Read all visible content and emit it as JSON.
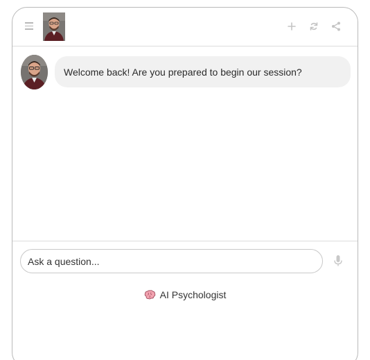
{
  "header": {
    "menu_icon": "hamburger-menu-icon",
    "avatar_alt": "psychologist-portrait",
    "actions": [
      {
        "icon": "plus-icon"
      },
      {
        "icon": "refresh-icon"
      },
      {
        "icon": "share-icon"
      }
    ]
  },
  "chat": {
    "messages": [
      {
        "sender": "assistant",
        "avatar": "psychologist-portrait",
        "text": "Welcome back! Are you prepared to begin our session?"
      }
    ]
  },
  "composer": {
    "placeholder": "Ask a question...",
    "mic_icon": "microphone-icon"
  },
  "footer": {
    "brand_icon": "brain-icon",
    "brand_label": "AI Psychologist"
  },
  "colors": {
    "bubble_bg": "#f1f1f1",
    "border": "#b9b9b9",
    "icon_gray": "#c4c4c4",
    "brain_pink": "#f2a3b0"
  }
}
